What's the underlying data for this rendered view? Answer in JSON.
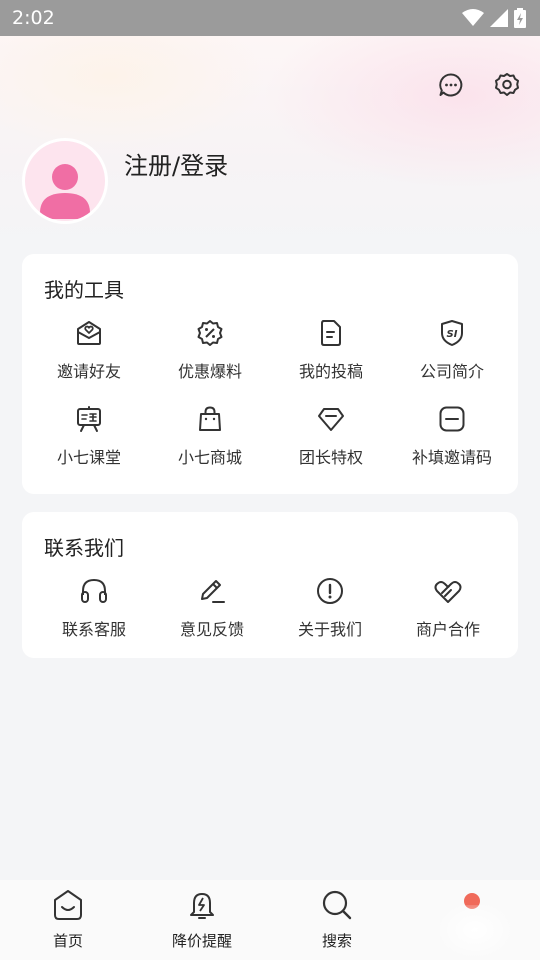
{
  "status_bar": {
    "time": "2:02"
  },
  "header": {
    "login_text": "注册/登录",
    "icons": [
      "message-icon",
      "settings-icon"
    ]
  },
  "tools": {
    "title": "我的工具",
    "items": [
      {
        "label": "邀请好友",
        "icon": "invite-icon"
      },
      {
        "label": "优惠爆料",
        "icon": "discount-icon"
      },
      {
        "label": "我的投稿",
        "icon": "document-icon"
      },
      {
        "label": "公司简介",
        "icon": "company-shield-icon"
      },
      {
        "label": "小七课堂",
        "icon": "classroom-icon"
      },
      {
        "label": "小七商城",
        "icon": "shopping-bag-icon"
      },
      {
        "label": "团长特权",
        "icon": "diamond-icon"
      },
      {
        "label": "补填邀请码",
        "icon": "code-icon"
      }
    ]
  },
  "contact": {
    "title": "联系我们",
    "items": [
      {
        "label": "联系客服",
        "icon": "headphones-icon"
      },
      {
        "label": "意见反馈",
        "icon": "edit-pen-icon"
      },
      {
        "label": "关于我们",
        "icon": "info-icon"
      },
      {
        "label": "商户合作",
        "icon": "handshake-icon"
      }
    ]
  },
  "bottom_nav": {
    "items": [
      {
        "label": "首页",
        "icon": "home-icon"
      },
      {
        "label": "降价提醒",
        "icon": "price-alert-icon"
      },
      {
        "label": "搜索",
        "icon": "search-icon"
      }
    ]
  },
  "colors": {
    "accent_pink": "#f06ea4",
    "avatar_bg": "#fde4ee",
    "badge_red": "#f06a5a"
  }
}
